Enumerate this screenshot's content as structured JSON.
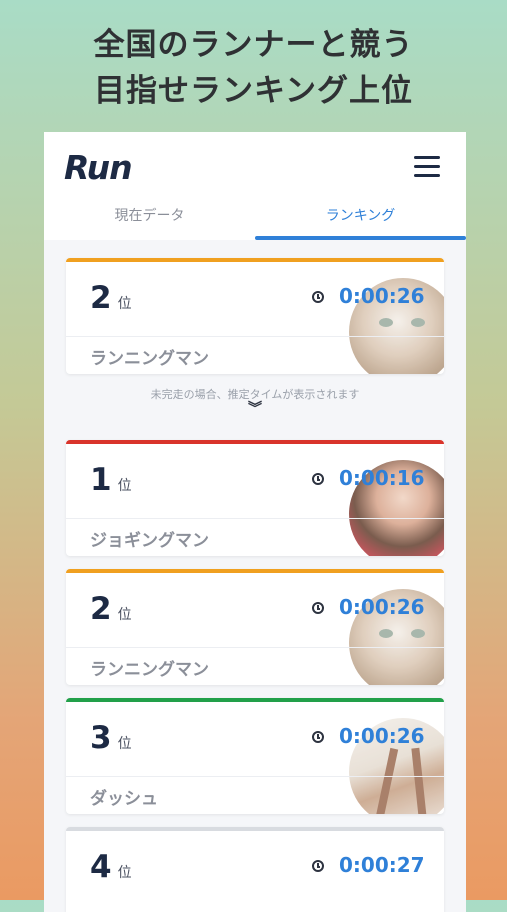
{
  "headline": {
    "line1": "全国のランナーと競う",
    "line2": "目指せランキング上位"
  },
  "app": {
    "logo": "Run",
    "menu_icon": "hamburger-menu-icon"
  },
  "tabs": [
    {
      "label": "現在データ",
      "active": false
    },
    {
      "label": "ランキング",
      "active": true
    }
  ],
  "my_entry": {
    "rank": "2",
    "rank_unit": "位",
    "time": "0:00:26",
    "name": "ランニングマン",
    "bar_color": "#f0a020",
    "avatar": "cat-photo"
  },
  "note": "未完走の場合、推定タイムが表示されます",
  "expand_icon": "chevron-double-down-icon",
  "ranking": [
    {
      "rank": "1",
      "rank_unit": "位",
      "time": "0:00:16",
      "name": "ジョギングマン",
      "bar_color": "#d9342b",
      "avatar": "woman-photo"
    },
    {
      "rank": "2",
      "rank_unit": "位",
      "time": "0:00:26",
      "name": "ランニングマン",
      "bar_color": "#f0a020",
      "avatar": "cat-photo"
    },
    {
      "rank": "3",
      "rank_unit": "位",
      "time": "0:00:26",
      "name": "ダッシュ",
      "bar_color": "#22a04a",
      "avatar": "chair-photo"
    },
    {
      "rank": "4",
      "rank_unit": "位",
      "time": "0:00:27",
      "name": "",
      "bar_color": "#d8dbe0",
      "avatar": ""
    }
  ]
}
